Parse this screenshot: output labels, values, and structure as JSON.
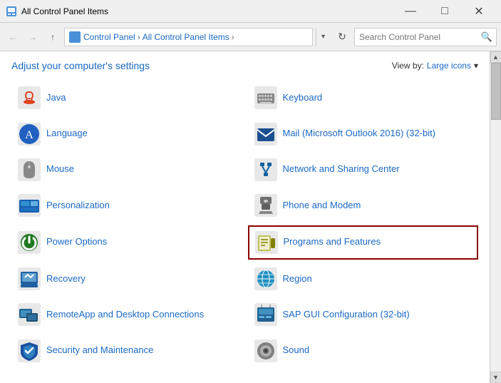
{
  "titleBar": {
    "title": "All Control Panel Items",
    "controls": {
      "minimize": "—",
      "maximize": "□",
      "close": "✕"
    }
  },
  "addressBar": {
    "back": "←",
    "forward": "→",
    "up": "↑",
    "path": [
      "Control Panel",
      "All Control Panel Items"
    ],
    "refresh": "↻",
    "search": {
      "placeholder": "Search Control Panel",
      "icon": "🔍"
    }
  },
  "content": {
    "pageTitle": "Adjust your computer's settings",
    "viewBy": {
      "label": "View by:",
      "value": "Large icons",
      "chevron": "▾"
    },
    "items": [
      {
        "id": "java",
        "label": "Java",
        "iconClass": "icon-java",
        "highlighted": false,
        "col": 0
      },
      {
        "id": "keyboard",
        "label": "Keyboard",
        "iconClass": "icon-keyboard",
        "highlighted": false,
        "col": 1
      },
      {
        "id": "language",
        "label": "Language",
        "iconClass": "icon-language",
        "highlighted": false,
        "col": 0
      },
      {
        "id": "mail",
        "label": "Mail (Microsoft Outlook 2016) (32-bit)",
        "iconClass": "icon-mail",
        "highlighted": false,
        "col": 1
      },
      {
        "id": "mouse",
        "label": "Mouse",
        "iconClass": "icon-mouse",
        "highlighted": false,
        "col": 0
      },
      {
        "id": "network",
        "label": "Network and Sharing Center",
        "iconClass": "icon-network",
        "highlighted": false,
        "col": 1
      },
      {
        "id": "personalization",
        "label": "Personalization",
        "iconClass": "icon-personalization",
        "highlighted": false,
        "col": 0
      },
      {
        "id": "phone",
        "label": "Phone and Modem",
        "iconClass": "icon-phone",
        "highlighted": false,
        "col": 1
      },
      {
        "id": "power",
        "label": "Power Options",
        "iconClass": "icon-power",
        "highlighted": false,
        "col": 0
      },
      {
        "id": "programs",
        "label": "Programs and Features",
        "iconClass": "icon-programs",
        "highlighted": true,
        "col": 1
      },
      {
        "id": "recovery",
        "label": "Recovery",
        "iconClass": "icon-recovery",
        "highlighted": false,
        "col": 0
      },
      {
        "id": "region",
        "label": "Region",
        "iconClass": "icon-region",
        "highlighted": false,
        "col": 1
      },
      {
        "id": "remoteapp",
        "label": "RemoteApp and Desktop Connections",
        "iconClass": "icon-remoteapp",
        "highlighted": false,
        "col": 0
      },
      {
        "id": "sapgui",
        "label": "SAP GUI Configuration (32-bit)",
        "iconClass": "icon-sapgui",
        "highlighted": false,
        "col": 1
      },
      {
        "id": "security",
        "label": "Security and Maintenance",
        "iconClass": "icon-security",
        "highlighted": false,
        "col": 0
      },
      {
        "id": "sound",
        "label": "Sound",
        "iconClass": "icon-sound",
        "highlighted": false,
        "col": 1
      }
    ]
  }
}
